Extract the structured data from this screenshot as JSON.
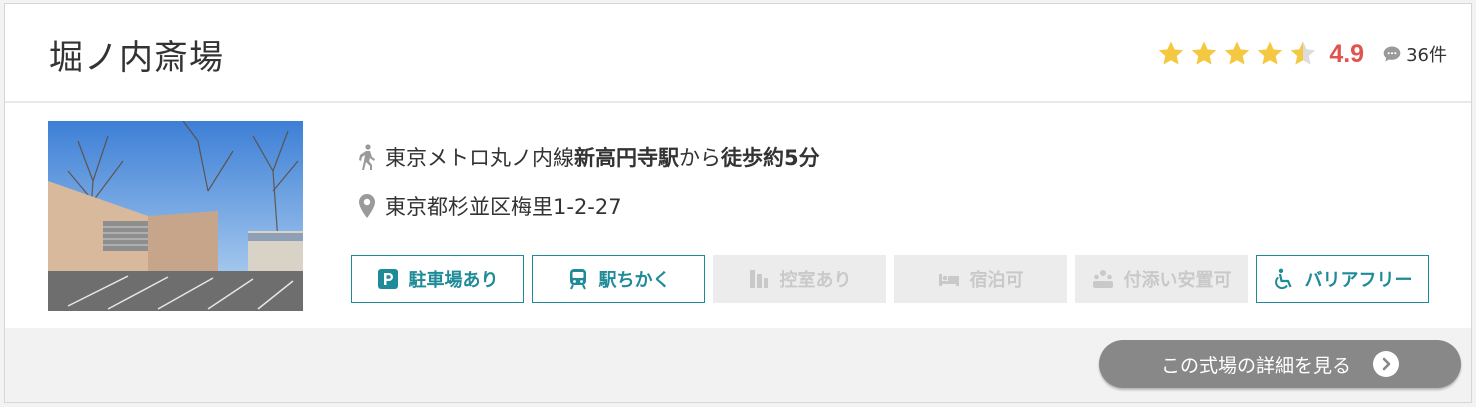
{
  "hall": {
    "name": "堀ノ内斎場",
    "rating_value": 4.9,
    "rating_text": "4.9",
    "review_count": "36件",
    "star_color": "#f5c842"
  },
  "access": {
    "line_prefix": "東京メトロ丸ノ内線 ",
    "station": "新高円寺駅",
    "from": "から",
    "walk": "徒歩約5分",
    "address": "東京都杉並区梅里1-2-27"
  },
  "features": [
    {
      "label": "駐車場あり",
      "icon": "parking-icon",
      "active": true
    },
    {
      "label": "駅ちかく",
      "icon": "train-icon",
      "active": true
    },
    {
      "label": "控室あり",
      "icon": "waiting-room-icon",
      "active": false
    },
    {
      "label": "宿泊可",
      "icon": "bed-icon",
      "active": false
    },
    {
      "label": "付添い安置可",
      "icon": "people-icon",
      "active": false
    },
    {
      "label": "バリアフリー",
      "icon": "wheelchair-icon",
      "active": true
    }
  ],
  "footer": {
    "detail_label": "この式場の詳細を見る"
  },
  "colors": {
    "accent": "#1f8b98",
    "score": "#e0534e",
    "button": "#888888"
  }
}
